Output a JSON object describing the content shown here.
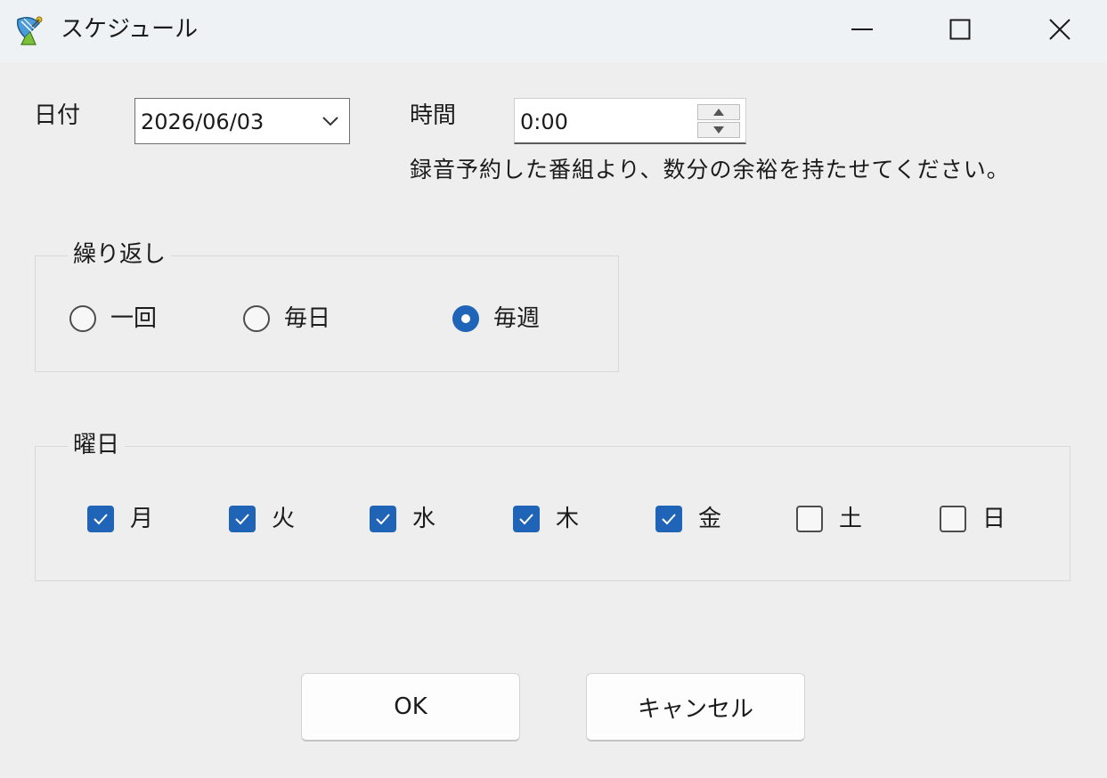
{
  "window": {
    "title": "スケジュール",
    "icon": "satellite-dish-icon",
    "controls": [
      "minimize-icon",
      "maximize-icon",
      "close-icon"
    ]
  },
  "date": {
    "label": "日付",
    "value": "2026/06/03"
  },
  "time": {
    "label": "時間",
    "value": "0:00"
  },
  "hint": "録音予約した番組より、数分の余裕を持たせてください。",
  "repeat": {
    "title": "繰り返し",
    "options": [
      {
        "label": "一回",
        "selected": false
      },
      {
        "label": "毎日",
        "selected": false
      },
      {
        "label": "毎週",
        "selected": true
      }
    ]
  },
  "days": {
    "title": "曜日",
    "items": [
      {
        "label": "月",
        "checked": true
      },
      {
        "label": "火",
        "checked": true
      },
      {
        "label": "水",
        "checked": true
      },
      {
        "label": "木",
        "checked": true
      },
      {
        "label": "金",
        "checked": true
      },
      {
        "label": "土",
        "checked": false
      },
      {
        "label": "日",
        "checked": false
      }
    ]
  },
  "buttons": {
    "ok": "OK",
    "cancel": "キャンセル"
  },
  "colors": {
    "accent": "#1f64b7",
    "background": "#eeeeee",
    "titlebar": "#eff2f4"
  }
}
